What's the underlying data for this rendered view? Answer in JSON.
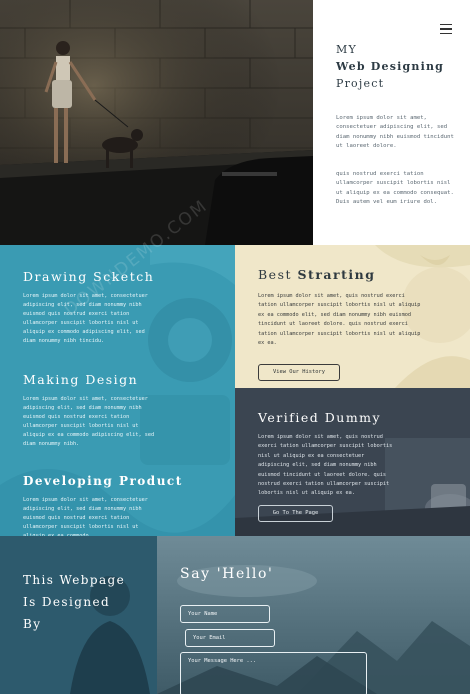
{
  "hero": {
    "menu_icon": "hamburger-menu-icon",
    "title_line1": "MY",
    "title_line2": "Web Designing",
    "title_line3": "Project",
    "paragraph1": "Lorem ipsum dolor sit amet, consectetuer adipiscing elit, sed diam nonummy nibh euismod tincidunt ut laoreet dolore.",
    "paragraph2": "quis nostrud exerci tation ullamcorper suscipit lobortis nisl ut aliquip ex ea commodo consequat. Duis autem vel eum iriure dol."
  },
  "services": [
    {
      "title": "Drawing Scketch",
      "text": "Lorem ipsum dolor sit amet, consectetuer adipiscing elit, sed diam nonummy nibh euismod quis nostrud exerci tation ullamcorper suscipit lobortis nisl ut aliquip ex commodo adipiscing elit, sed diam nonummy nibh tincidu."
    },
    {
      "title": "Making Design",
      "text": "Lorem ipsum dolor sit amet, consectetuer adipiscing elit, sed diam nonummy nibh euismod quis nostrud exerci tation ullamcorper suscipit lobortis nisl ut aliquip ex ea commodo adipiscing elit, sed diam nonummy nibh."
    },
    {
      "title": "Developing Product",
      "text": "Lorem ipsum dolor sit amet, consectetuer adipiscing elit, sed diam nonummy nibh euismod quis nostrud exerci tation ullamcorper suscipit lobortis nisl ut aliquip ex ea commodo."
    }
  ],
  "best": {
    "title_prefix": "Best",
    "title_strong": "Strarting",
    "text": "Lorem ipsum dolor sit amet, quis nostrud exerci tation ullamcorper suscipit lobortis nisl ut aliquip ex ea commodo elit, sed diam nonummy nibh euismod tincidunt ut laoreet dolore. quis nostrud exerci tation ullamcorper suscipit lobortis nisl ut aliquip ex ea.",
    "button": "View Our History"
  },
  "verified": {
    "title": "Verified Dummy",
    "text": "Lorem ipsum dolor sit amet, quis nostrud exerci tation ullamcorper suscipit lobortis nisl ut aliquip ex ea consectetuer adipiscing elit, sed diam nonummy nibh euismod tincidunt ut laoreet dolore. quis nostrud exerci tation ullamcorper suscipit lobortis nisl ut aliquip ex ea.",
    "button": "Go To The Page"
  },
  "footer": {
    "line1": "This Webpage",
    "line2": "Is Designed",
    "line3": "By"
  },
  "contact": {
    "title": "Say 'Hello'",
    "name_placeholder": "Your Name",
    "email_placeholder": "Your Email",
    "message_placeholder": "Your Message Here ..."
  },
  "watermark": "DOWNDEMO.COM",
  "colors": {
    "teal": "#3a9bb3",
    "cream": "#f0e7c9",
    "slate": "#3b4551",
    "ink": "#2d3b44"
  }
}
